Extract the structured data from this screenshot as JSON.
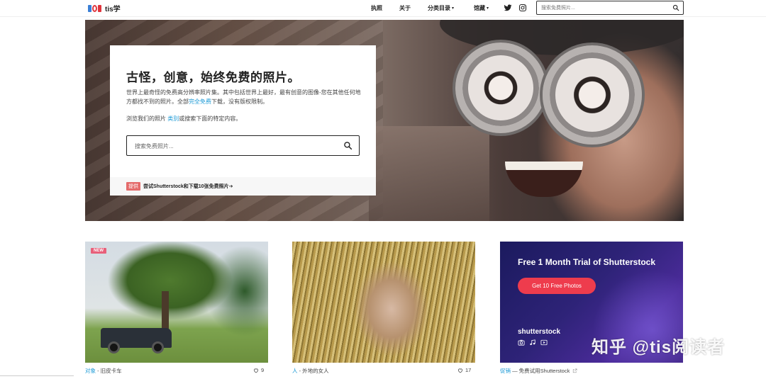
{
  "site": {
    "logo_text": "tis学"
  },
  "nav": {
    "items": [
      {
        "label": "执照"
      },
      {
        "label": "关于"
      },
      {
        "label": "分类目录",
        "caret": "▾"
      },
      {
        "label": "馆藏",
        "caret": "▾"
      }
    ],
    "social": [
      "twitter-icon",
      "instagram-icon"
    ],
    "search_placeholder": "搜索免费照片..."
  },
  "hero": {
    "title": "古怪，创意，始终免费的照片。",
    "desc_part1": "世界上最奇怪的免费高分辨率照片集。其中包括世界上最好，最有创意的图像-您在其他任何地方都找不到的照片。全部",
    "desc_highlight": "完全免费",
    "desc_part2": "下载，没有版权限制。",
    "browse_part1": "浏览我们的照片 ",
    "browse_highlight": "类别",
    "browse_part2": "或搜索下面的特定内容。",
    "search_placeholder": "搜索免费照片...",
    "promo_badge": "提供",
    "promo_text": "尝试Shutterstock和下载10张免费照片➔"
  },
  "cards": [
    {
      "badge": "NEW",
      "category": "对象",
      "separator": " - ",
      "title": "旧皮卡车",
      "likes": "9"
    },
    {
      "category": "人",
      "separator": " - ",
      "title": "外地的女人",
      "likes": "17"
    },
    {
      "ad_title": "Free 1 Month Trial of Shutterstock",
      "ad_button": "Get 10 Free Photos",
      "ad_brand": "shutterstock",
      "category": "促销",
      "separator": " — ",
      "title": "免费试用Shutterstock"
    }
  ],
  "watermark": "知乎 @tis阅读者",
  "colors": {
    "accent": "#1c9ad6",
    "promo_badge": "#e46b6b",
    "cta": "#ee3c4d",
    "new_badge": "#e8607a"
  }
}
